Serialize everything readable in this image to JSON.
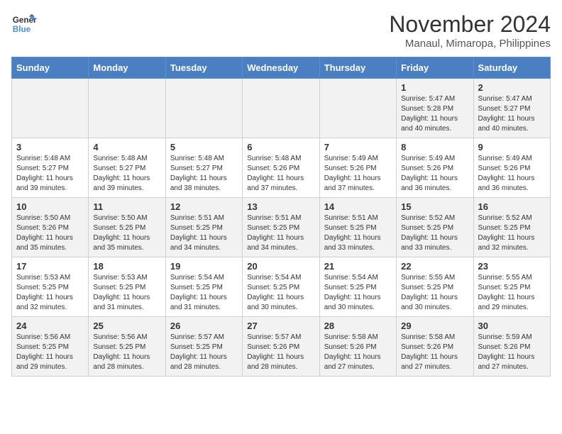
{
  "logo": {
    "line1": "General",
    "line2": "Blue"
  },
  "title": "November 2024",
  "subtitle": "Manaul, Mimaropa, Philippines",
  "weekdays": [
    "Sunday",
    "Monday",
    "Tuesday",
    "Wednesday",
    "Thursday",
    "Friday",
    "Saturday"
  ],
  "weeks": [
    [
      {
        "day": "",
        "info": ""
      },
      {
        "day": "",
        "info": ""
      },
      {
        "day": "",
        "info": ""
      },
      {
        "day": "",
        "info": ""
      },
      {
        "day": "",
        "info": ""
      },
      {
        "day": "1",
        "info": "Sunrise: 5:47 AM\nSunset: 5:28 PM\nDaylight: 11 hours and 40 minutes."
      },
      {
        "day": "2",
        "info": "Sunrise: 5:47 AM\nSunset: 5:27 PM\nDaylight: 11 hours and 40 minutes."
      }
    ],
    [
      {
        "day": "3",
        "info": "Sunrise: 5:48 AM\nSunset: 5:27 PM\nDaylight: 11 hours and 39 minutes."
      },
      {
        "day": "4",
        "info": "Sunrise: 5:48 AM\nSunset: 5:27 PM\nDaylight: 11 hours and 39 minutes."
      },
      {
        "day": "5",
        "info": "Sunrise: 5:48 AM\nSunset: 5:27 PM\nDaylight: 11 hours and 38 minutes."
      },
      {
        "day": "6",
        "info": "Sunrise: 5:48 AM\nSunset: 5:26 PM\nDaylight: 11 hours and 37 minutes."
      },
      {
        "day": "7",
        "info": "Sunrise: 5:49 AM\nSunset: 5:26 PM\nDaylight: 11 hours and 37 minutes."
      },
      {
        "day": "8",
        "info": "Sunrise: 5:49 AM\nSunset: 5:26 PM\nDaylight: 11 hours and 36 minutes."
      },
      {
        "day": "9",
        "info": "Sunrise: 5:49 AM\nSunset: 5:26 PM\nDaylight: 11 hours and 36 minutes."
      }
    ],
    [
      {
        "day": "10",
        "info": "Sunrise: 5:50 AM\nSunset: 5:26 PM\nDaylight: 11 hours and 35 minutes."
      },
      {
        "day": "11",
        "info": "Sunrise: 5:50 AM\nSunset: 5:25 PM\nDaylight: 11 hours and 35 minutes."
      },
      {
        "day": "12",
        "info": "Sunrise: 5:51 AM\nSunset: 5:25 PM\nDaylight: 11 hours and 34 minutes."
      },
      {
        "day": "13",
        "info": "Sunrise: 5:51 AM\nSunset: 5:25 PM\nDaylight: 11 hours and 34 minutes."
      },
      {
        "day": "14",
        "info": "Sunrise: 5:51 AM\nSunset: 5:25 PM\nDaylight: 11 hours and 33 minutes."
      },
      {
        "day": "15",
        "info": "Sunrise: 5:52 AM\nSunset: 5:25 PM\nDaylight: 11 hours and 33 minutes."
      },
      {
        "day": "16",
        "info": "Sunrise: 5:52 AM\nSunset: 5:25 PM\nDaylight: 11 hours and 32 minutes."
      }
    ],
    [
      {
        "day": "17",
        "info": "Sunrise: 5:53 AM\nSunset: 5:25 PM\nDaylight: 11 hours and 32 minutes."
      },
      {
        "day": "18",
        "info": "Sunrise: 5:53 AM\nSunset: 5:25 PM\nDaylight: 11 hours and 31 minutes."
      },
      {
        "day": "19",
        "info": "Sunrise: 5:54 AM\nSunset: 5:25 PM\nDaylight: 11 hours and 31 minutes."
      },
      {
        "day": "20",
        "info": "Sunrise: 5:54 AM\nSunset: 5:25 PM\nDaylight: 11 hours and 30 minutes."
      },
      {
        "day": "21",
        "info": "Sunrise: 5:54 AM\nSunset: 5:25 PM\nDaylight: 11 hours and 30 minutes."
      },
      {
        "day": "22",
        "info": "Sunrise: 5:55 AM\nSunset: 5:25 PM\nDaylight: 11 hours and 30 minutes."
      },
      {
        "day": "23",
        "info": "Sunrise: 5:55 AM\nSunset: 5:25 PM\nDaylight: 11 hours and 29 minutes."
      }
    ],
    [
      {
        "day": "24",
        "info": "Sunrise: 5:56 AM\nSunset: 5:25 PM\nDaylight: 11 hours and 29 minutes."
      },
      {
        "day": "25",
        "info": "Sunrise: 5:56 AM\nSunset: 5:25 PM\nDaylight: 11 hours and 28 minutes."
      },
      {
        "day": "26",
        "info": "Sunrise: 5:57 AM\nSunset: 5:25 PM\nDaylight: 11 hours and 28 minutes."
      },
      {
        "day": "27",
        "info": "Sunrise: 5:57 AM\nSunset: 5:26 PM\nDaylight: 11 hours and 28 minutes."
      },
      {
        "day": "28",
        "info": "Sunrise: 5:58 AM\nSunset: 5:26 PM\nDaylight: 11 hours and 27 minutes."
      },
      {
        "day": "29",
        "info": "Sunrise: 5:58 AM\nSunset: 5:26 PM\nDaylight: 11 hours and 27 minutes."
      },
      {
        "day": "30",
        "info": "Sunrise: 5:59 AM\nSunset: 5:26 PM\nDaylight: 11 hours and 27 minutes."
      }
    ]
  ]
}
